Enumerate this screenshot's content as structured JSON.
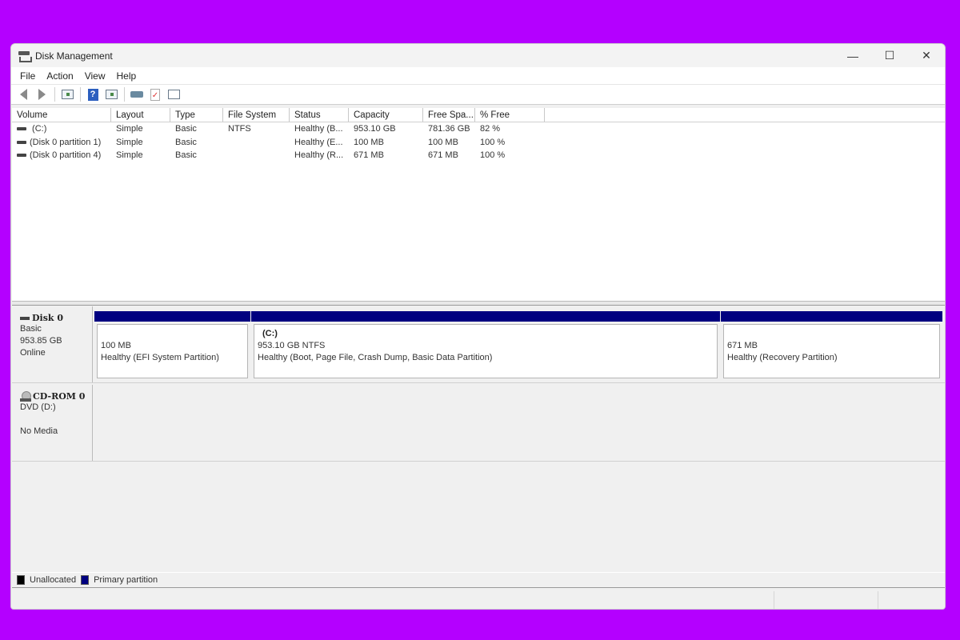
{
  "window": {
    "title": "Disk Management",
    "controls": {
      "minimize": "—",
      "maximize": "☐",
      "close": "✕"
    }
  },
  "menubar": [
    "File",
    "Action",
    "View",
    "Help"
  ],
  "toolbar": {
    "buttons": [
      "back-icon",
      "forward-icon",
      "show-hide-console-tree-icon",
      "help-icon",
      "show-action-pane-icon",
      "connect-icon",
      "properties-check-icon",
      "list-icon"
    ]
  },
  "volume_list": {
    "columns": [
      "Volume",
      "Layout",
      "Type",
      "File System",
      "Status",
      "Capacity",
      "Free Spa...",
      "% Free"
    ],
    "rows": [
      {
        "volume": " (C:)",
        "layout": "Simple",
        "type": "Basic",
        "fs": "NTFS",
        "status": "Healthy (B...",
        "capacity": "953.10 GB",
        "free": "781.36 GB",
        "pct": "82 %"
      },
      {
        "volume": "(Disk 0 partition 1)",
        "layout": "Simple",
        "type": "Basic",
        "fs": "",
        "status": "Healthy (E...",
        "capacity": "100 MB",
        "free": "100 MB",
        "pct": "100 %"
      },
      {
        "volume": "(Disk 0 partition 4)",
        "layout": "Simple",
        "type": "Basic",
        "fs": "",
        "status": "Healthy (R...",
        "capacity": "671 MB",
        "free": "671 MB",
        "pct": "100 %"
      }
    ]
  },
  "disks": [
    {
      "name": "Disk 0",
      "type": "Basic",
      "size": "953.85 GB",
      "state": "Online",
      "partitions": [
        {
          "name": "",
          "size": "100 MB",
          "status": "Healthy (EFI System Partition)"
        },
        {
          "name": "(C:)",
          "size": "953.10 GB NTFS",
          "status": "Healthy (Boot, Page File, Crash Dump, Basic Data Partition)"
        },
        {
          "name": "",
          "size": "671 MB",
          "status": "Healthy (Recovery Partition)"
        }
      ]
    },
    {
      "name": "CD-ROM 0",
      "type": "DVD (D:)",
      "media": "No Media"
    }
  ],
  "legend": [
    {
      "label": "Unallocated",
      "color": "#000000"
    },
    {
      "label": "Primary partition",
      "color": "#000080"
    }
  ],
  "colors": {
    "partition_bar": "#000080",
    "background": "#b400ff"
  }
}
